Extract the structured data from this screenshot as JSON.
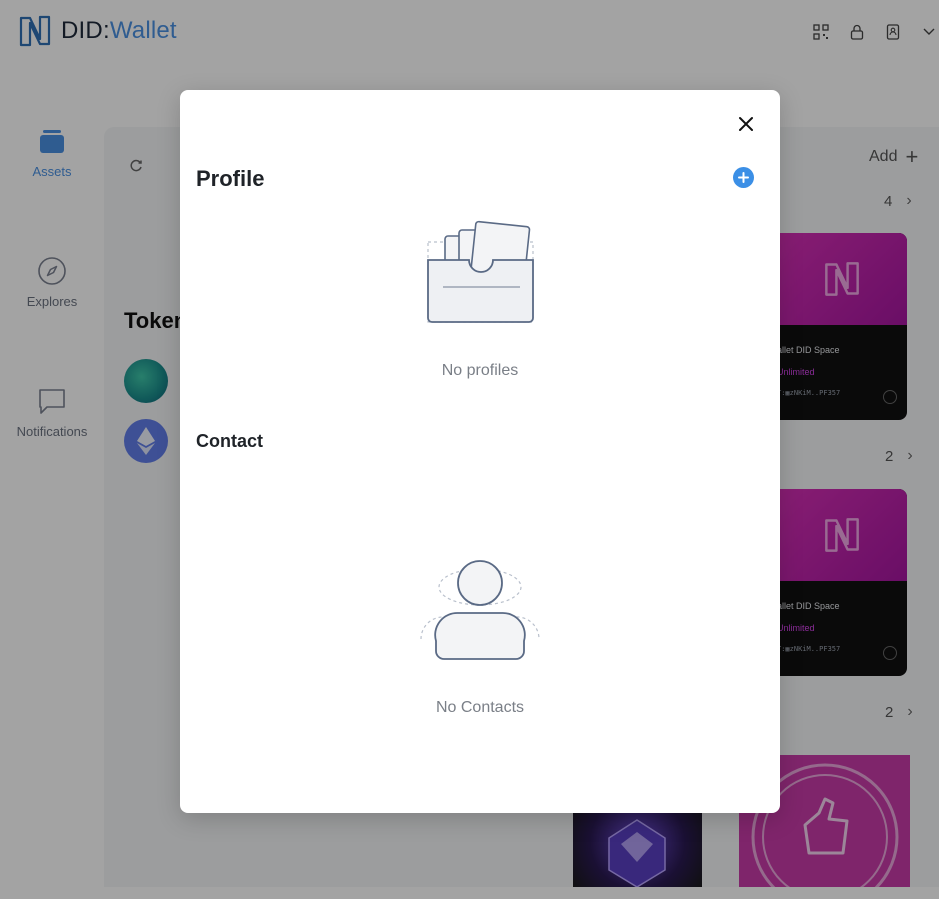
{
  "app": {
    "logo_did": "DID",
    "logo_colon": ":",
    "logo_wallet": "Wallet"
  },
  "sidebar": {
    "items": [
      {
        "label": "Assets",
        "icon": "wallet-stack-icon",
        "active": true
      },
      {
        "label": "Explores",
        "icon": "compass-icon",
        "active": false
      },
      {
        "label": "Notifications",
        "icon": "chat-bubble-icon",
        "active": false
      }
    ]
  },
  "main": {
    "tokens_title": "Token",
    "add_label": "Add",
    "group_counts": [
      "4",
      "2",
      "2"
    ]
  },
  "nft_cards": [
    {
      "name": "allet DID Space",
      "capacity": "Unlimited",
      "address": "T:▦zNKiM..PF357"
    },
    {
      "name": "allet DID Space",
      "capacity": "Unlimited",
      "address": "T:▦zNKiM..PF357"
    }
  ],
  "modal": {
    "profile_title": "Profile",
    "no_profiles": "No profiles",
    "contact_title": "Contact",
    "no_contacts": "No Contacts"
  },
  "colors": {
    "accent": "#4a90e2",
    "add_button": "#3b8fe6",
    "nft_magenta": "#c42fb0",
    "overlay": "rgba(0,0,0,0.36)"
  }
}
